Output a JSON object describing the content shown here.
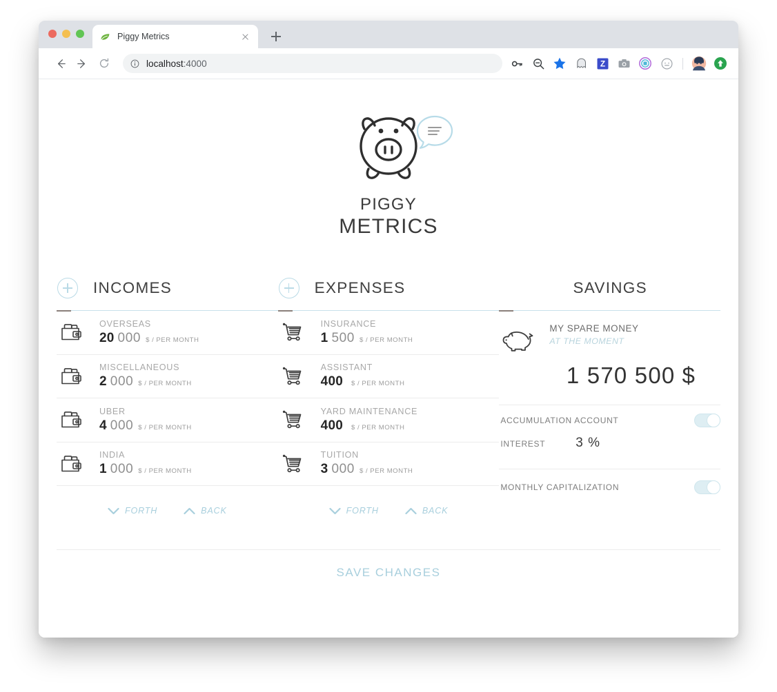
{
  "browser": {
    "tab": {
      "title": "Piggy Metrics",
      "favicon": "leaf-icon",
      "close": "close-icon"
    },
    "new_tab": "new-tab-icon",
    "nav": {
      "back": "back-arrow-icon",
      "forward": "forward-arrow-icon",
      "reload": "reload-icon"
    },
    "omnibox": {
      "info_icon": "info-circle-icon",
      "url_host": "localhost",
      "url_port": ":4000"
    },
    "extensions": [
      {
        "name": "password-key-icon"
      },
      {
        "name": "zoom-out-magnifier-icon"
      },
      {
        "name": "bookmark-star-icon"
      },
      {
        "name": "ghostery-icon"
      },
      {
        "name": "zotero-icon"
      },
      {
        "name": "screenshot-camera-icon"
      },
      {
        "name": "circle-target-icon"
      },
      {
        "name": "smiley-face-icon"
      },
      {
        "name": "profile-avatar-icon"
      },
      {
        "name": "green-upload-icon"
      }
    ]
  },
  "brand": {
    "logo": "piggy-bank-logo",
    "chat_icon": "chat-bubble-icon",
    "name_top": "PIGGY",
    "name_bottom": "METRICS"
  },
  "incomes": {
    "title": "INCOMES",
    "add_label": "plus-icon",
    "items": [
      {
        "icon": "wallet-icon",
        "label": "OVERSEAS",
        "amount_main": "20",
        "amount_rest": "000",
        "unit": "$ / PER MONTH"
      },
      {
        "icon": "wallet-icon",
        "label": "MISCELLANEOUS",
        "amount_main": "2",
        "amount_rest": "000",
        "unit": "$ / PER MONTH"
      },
      {
        "icon": "wallet-icon",
        "label": "UBER",
        "amount_main": "4",
        "amount_rest": "000",
        "unit": "$ / PER MONTH"
      },
      {
        "icon": "wallet-icon",
        "label": "INDIA",
        "amount_main": "1",
        "amount_rest": "000",
        "unit": "$ / PER MONTH"
      }
    ],
    "pager": {
      "forth": "FORTH",
      "back": "BACK"
    }
  },
  "expenses": {
    "title": "EXPENSES",
    "add_label": "plus-icon",
    "items": [
      {
        "icon": "shopping-cart-icon",
        "label": "INSURANCE",
        "amount_main": "1",
        "amount_rest": "500",
        "unit": "$ / PER MONTH"
      },
      {
        "icon": "shopping-cart-icon",
        "label": "ASSISTANT",
        "amount_main": "400",
        "amount_rest": "",
        "unit": "$ / PER MONTH"
      },
      {
        "icon": "shopping-cart-icon",
        "label": "YARD MAINTENANCE",
        "amount_main": "400",
        "amount_rest": "",
        "unit": "$ / PER MONTH"
      },
      {
        "icon": "shopping-cart-icon",
        "label": "TUITION",
        "amount_main": "3",
        "amount_rest": "000",
        "unit": "$ / PER MONTH"
      }
    ],
    "pager": {
      "forth": "FORTH",
      "back": "BACK"
    }
  },
  "savings": {
    "title": "SAVINGS",
    "icon": "piggy-bank-side-icon",
    "account_title": "MY SPARE MONEY",
    "account_sub": "AT THE MOMENT",
    "amount": "1 570 500",
    "currency": "$",
    "accumulation_label": "ACCUMULATION ACCOUNT",
    "accumulation_on": true,
    "interest_label": "INTEREST",
    "interest_value": "3 %",
    "capitalization_label": "MONTHLY CAPITALIZATION",
    "capitalization_on": true
  },
  "footer": {
    "save_label": "SAVE CHANGES"
  },
  "colors": {
    "accent_blue": "#a8cfdd",
    "rule_blue": "#c7e0ea",
    "text_dark": "#262626",
    "text_muted": "#a8a8a8"
  }
}
